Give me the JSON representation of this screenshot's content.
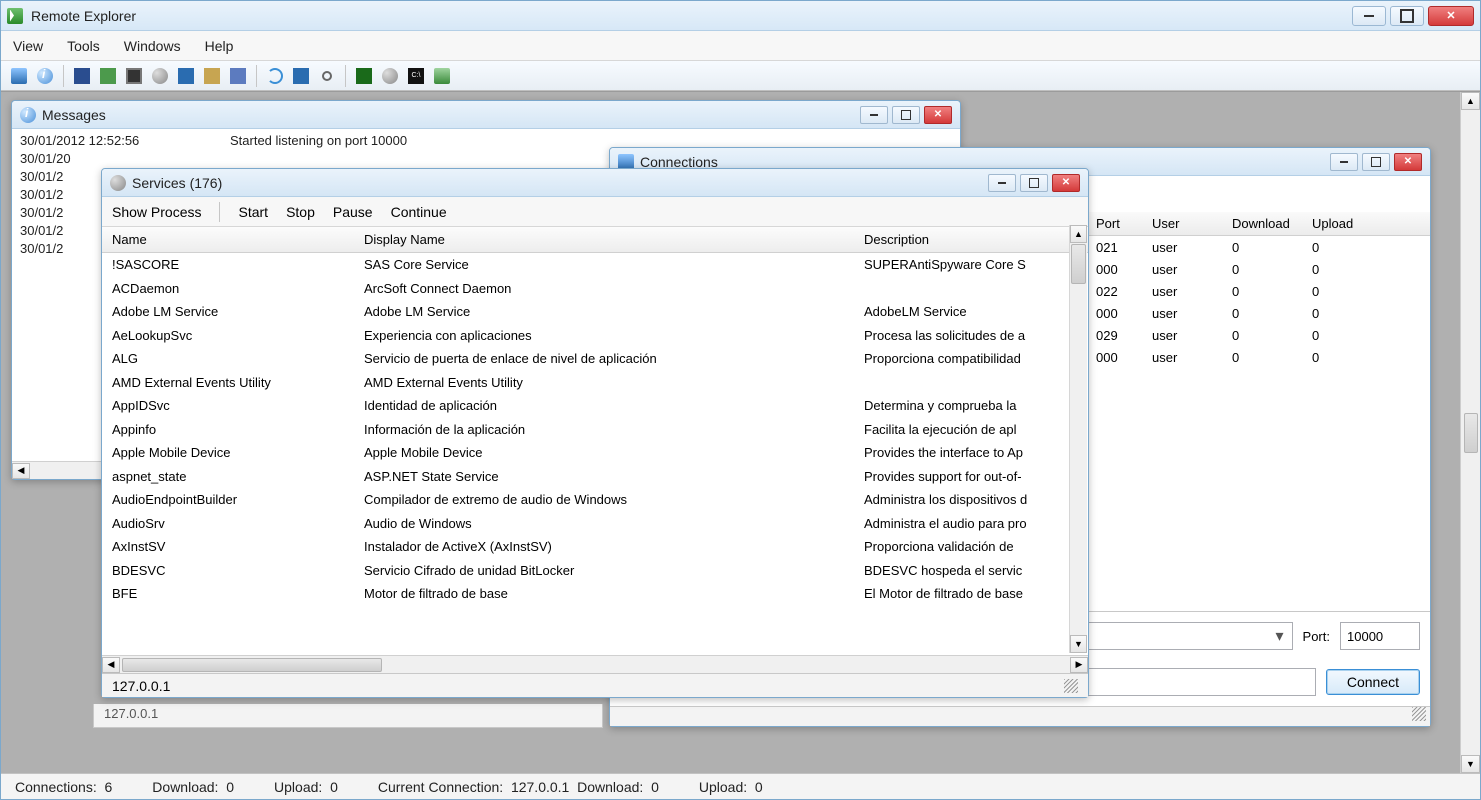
{
  "app": {
    "title": "Remote Explorer",
    "menubar": [
      "View",
      "Tools",
      "Windows",
      "Help"
    ]
  },
  "messages_window": {
    "title": "Messages",
    "rows": [
      {
        "ts": "30/01/2012 12:52:56",
        "text": "Started listening on port 10000"
      },
      {
        "ts": "30/01/20",
        "text": ""
      },
      {
        "ts": "30/01/2",
        "text": ""
      },
      {
        "ts": "30/01/2",
        "text": ""
      },
      {
        "ts": "30/01/2",
        "text": ""
      },
      {
        "ts": "30/01/2",
        "text": ""
      },
      {
        "ts": "30/01/2",
        "text": ""
      }
    ]
  },
  "connections_window": {
    "title": "Connections",
    "columns": [
      "Port",
      "User",
      "Download",
      "Upload"
    ],
    "rows": [
      {
        "port": "021",
        "user": "user",
        "dl": "0",
        "ul": "0"
      },
      {
        "port": "000",
        "user": "user",
        "dl": "0",
        "ul": "0"
      },
      {
        "port": "022",
        "user": "user",
        "dl": "0",
        "ul": "0"
      },
      {
        "port": "000",
        "user": "user",
        "dl": "0",
        "ul": "0"
      },
      {
        "port": "029",
        "user": "user",
        "dl": "0",
        "ul": "0"
      },
      {
        "port": "000",
        "user": "user",
        "dl": "0",
        "ul": "0"
      }
    ],
    "port_label": "Port:",
    "port_value": "10000",
    "connect_label": "Connect",
    "status_ip": "127.0.0.1"
  },
  "services_window": {
    "title": "Services (176)",
    "toolbar": [
      "Show Process",
      "Start",
      "Stop",
      "Pause",
      "Continue"
    ],
    "columns": [
      "Name",
      "Display Name",
      "Description"
    ],
    "rows": [
      {
        "name": "!SASCORE",
        "disp": "SAS Core Service",
        "desc": "SUPERAntiSpyware Core S"
      },
      {
        "name": "ACDaemon",
        "disp": "ArcSoft Connect Daemon",
        "desc": ""
      },
      {
        "name": "Adobe LM Service",
        "disp": "Adobe LM Service",
        "desc": "AdobeLM Service"
      },
      {
        "name": "AeLookupSvc",
        "disp": "Experiencia con aplicaciones",
        "desc": "Procesa las solicitudes de a"
      },
      {
        "name": "ALG",
        "disp": "Servicio de puerta de enlace de nivel de aplicación",
        "desc": "Proporciona compatibilidad"
      },
      {
        "name": "AMD External Events Utility",
        "disp": "AMD External Events Utility",
        "desc": ""
      },
      {
        "name": "AppIDSvc",
        "disp": "Identidad de aplicación",
        "desc": "Determina y comprueba la"
      },
      {
        "name": "Appinfo",
        "disp": "Información de la aplicación",
        "desc": "Facilita la ejecución de apl"
      },
      {
        "name": "Apple Mobile Device",
        "disp": "Apple Mobile Device",
        "desc": "Provides the interface to Ap"
      },
      {
        "name": "aspnet_state",
        "disp": "ASP.NET State Service",
        "desc": "Provides support for out-of-"
      },
      {
        "name": "AudioEndpointBuilder",
        "disp": "Compilador de extremo de audio de Windows",
        "desc": "Administra los dispositivos d"
      },
      {
        "name": "AudioSrv",
        "disp": "Audio de Windows",
        "desc": "Administra el audio para pro"
      },
      {
        "name": "AxInstSV",
        "disp": "Instalador de ActiveX (AxInstSV)",
        "desc": "Proporciona validación de"
      },
      {
        "name": "BDESVC",
        "disp": "Servicio Cifrado de unidad BitLocker",
        "desc": "BDESVC hospeda el servic"
      },
      {
        "name": "BFE",
        "disp": "Motor de filtrado de base",
        "desc": "El Motor de filtrado de base"
      }
    ],
    "status": "127.0.0.1"
  },
  "statusbar": {
    "connections_label": "Connections:",
    "connections_value": "6",
    "download_label": "Download:",
    "download_value": "0",
    "upload_label": "Upload:",
    "upload_value": "0",
    "current_label": "Current Connection:",
    "current_value": "127.0.0.1",
    "cur_dl_label": "Download:",
    "cur_dl_value": "0",
    "cur_ul_label": "Upload:",
    "cur_ul_value": "0"
  }
}
